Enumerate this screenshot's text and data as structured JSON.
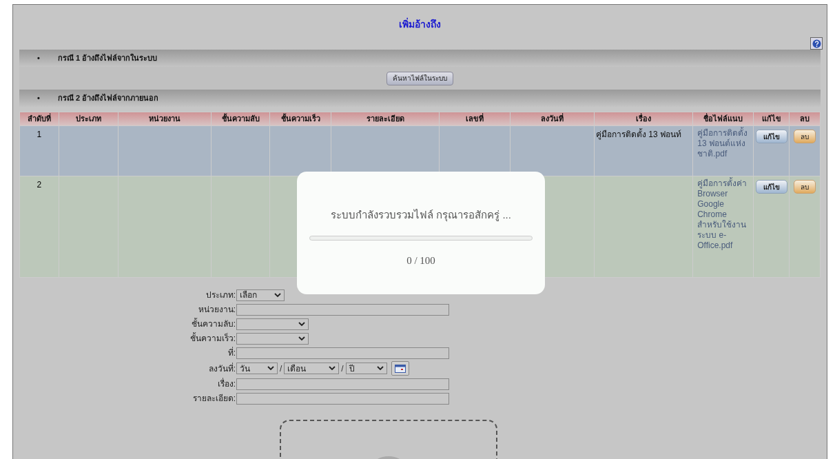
{
  "title": "เพิ่มอ้างถึง",
  "sections": [
    {
      "bullet": "•",
      "label": "กรณี 1 อ้างถึงไฟล์จากในระบบ"
    },
    {
      "bullet": "•",
      "label": "กรณี 2 อ้างถึงไฟล์จากภายนอก"
    }
  ],
  "search_button": "ค้นหาไฟล์ในระบบ",
  "table": {
    "columns": [
      "ลำดับที่",
      "ประเภท",
      "หน่วยงาน",
      "ชั้นความลับ",
      "ชั้นความเร็ว",
      "รายละเอียด",
      "เลขที่",
      "ลงวันที่",
      "เรื่อง",
      "ชื่อไฟล์แนบ",
      "แก้ไข",
      "ลบ"
    ],
    "rows": [
      {
        "index": "1",
        "subject": "คู่มือการติดตั้ง 13 ฟอนท์",
        "file": "คู่มือการติดตั้ง 13 ฟอนต์แห่งชาติ.pdf",
        "edit": "แก้ไข",
        "delete": "ลบ",
        "color": "#aab6c4"
      },
      {
        "index": "2",
        "file": "คู่มือการตั้งค่า Browser Google Chrome สำหรับใช้งานระบบ e-Office.pdf",
        "edit": "แก้ไข",
        "delete": "ลบ",
        "color": "#bcc8ba"
      }
    ]
  },
  "form": [
    {
      "label": "ประเภท:",
      "kind": "select",
      "value": "เลือก"
    },
    {
      "label": "หน่วยงาน:",
      "kind": "text"
    },
    {
      "label": "ชั้นความลับ:",
      "kind": "select"
    },
    {
      "label": "ชั้นความเร็ว:",
      "kind": "select"
    },
    {
      "label": "ที่:",
      "kind": "text"
    },
    {
      "label": "ลงวันที่:",
      "kind": "date",
      "items": [
        {
          "kind": "select",
          "value": "วัน"
        },
        {
          "kind": "sep",
          "text": "/"
        },
        {
          "kind": "select",
          "value": "เดือน"
        },
        {
          "kind": "sep",
          "text": "/"
        },
        {
          "kind": "select",
          "value": "ปี"
        },
        {
          "kind": "calendar"
        }
      ]
    },
    {
      "label": "เรื่อง:",
      "kind": "text"
    },
    {
      "label": "รายละเอียด:",
      "kind": "text"
    }
  ],
  "modal": {
    "message": "ระบบกำลังรวบรวมไฟล์ กรุณารอสักครู่ ...",
    "level": 0,
    "progress_text": "0 / 100"
  }
}
